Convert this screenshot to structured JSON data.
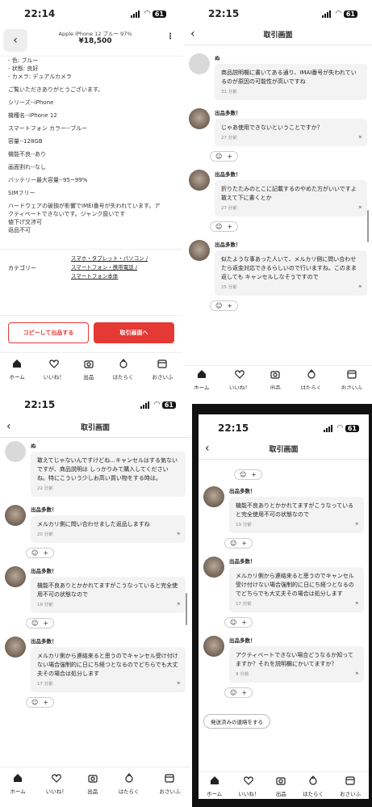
{
  "p1": {
    "time": "22:14",
    "battery": "61",
    "product_title": "Apple iPhone 12 ブルー 97%",
    "price": "¥18,500",
    "lines": [
      "- 色: ブルー",
      "- 状態: 良好",
      "- カメラ: デュアルカメラ",
      "",
      "ご覧いただきありがとうございます。",
      "",
      "シリーズ--iPhone",
      "",
      "機種名--iPhone 12",
      "",
      "スマートフォン カラー--ブルー",
      "",
      "容量--128GB",
      "",
      "機能不良--あり",
      "",
      "画面割れ--なし",
      "",
      "バッテリー最大容量--95~99%",
      "",
      "SIMフリー",
      "",
      "ハードウェアの破損が影響でIMEI番号が失われています。ア",
      "クティベートできないです。ジャンク扱いです",
      "値下げ交渉可",
      "返品不可"
    ],
    "category_label": "カテゴリー",
    "category_links": [
      "スマホ・タブレット・パソコン /",
      "スマートフォン・携帯電話 /",
      "スマートフォン本体"
    ],
    "copy_button": "コピーして出品する",
    "trade_button": "取引画面へ"
  },
  "header_title": "取引画面",
  "tabs": [
    "ホーム",
    "いいね！",
    "出品",
    "はたらく",
    "おさいふ"
  ],
  "p2": {
    "time": "22:15",
    "battery": "61",
    "messages": [
      {
        "sender": "ぬ",
        "text": "商品説明欄に書いてある通り、IMAI番号が失われているのが原因の可能性が高いですね",
        "time": "31 分前",
        "gray": true,
        "react": false
      },
      {
        "sender": "出品多数！",
        "text": "じゃあ使用できないということですか？",
        "time": "27 分前",
        "gray": false,
        "react": true
      },
      {
        "sender": "出品多数！",
        "text": "折りたたみのとこに記載するのやめた方がいいですよ敢えて下に書くとか",
        "time": "27 分前",
        "gray": false,
        "react": true
      },
      {
        "sender": "出品多数！",
        "text": "似たような事あった人いて、メルカリ側に問い合わせたら返金対応できるらしいので行いますね。このまま返しても キャンセルしなそうですので",
        "time": "25 分前",
        "gray": false,
        "react": true
      }
    ]
  },
  "p3": {
    "time": "22:15",
    "battery": "61",
    "messages": [
      {
        "sender": "ぬ",
        "text": "敢えてじゃないんですけどね...キャンセルはする気ないですが、商品説明は しっかりみて購入してくださいね。特にこういう少しお高い買い物をする時は。",
        "time": "22 分前",
        "gray": true,
        "react": false
      },
      {
        "sender": "出品多数！",
        "text": "メルカリ側に問い合わせました返品しますね",
        "time": "20 分前",
        "gray": false,
        "react": true
      },
      {
        "sender": "出品多数！",
        "text": "機能不良ありとかかれてますがこうなっていると完全使用不可の状態なので",
        "time": "19 分前",
        "gray": false,
        "react": true
      },
      {
        "sender": "出品多数！",
        "text": "メルカリ側から連絡来ると思うのでキャンセル受け付けない場合強制的に日にち経つとなるのでどちらでも大丈夫その場合は処分します",
        "time": "17 分前",
        "gray": false,
        "react": true
      }
    ]
  },
  "p4": {
    "time": "22:15",
    "battery": "61",
    "messages": [
      {
        "sender": "出品多数！",
        "text": "機能不良ありとかかれてますがこうなっていると完全使用不可の状態なので",
        "time": "19 分前",
        "gray": false,
        "react": true
      },
      {
        "sender": "出品多数！",
        "text": "メルカリ側から連絡来ると思うのでキャンセル受け付けない場合強制的に日にち経つとなるのでどちらでも大丈夫その場合は処分します",
        "time": "17 分前",
        "gray": false,
        "react": true
      },
      {
        "sender": "出品多数！",
        "text": "アクティベートできない場合どうなるか知ってますか？それを説明欄にかいてますか？",
        "time": "9 分前",
        "gray": false,
        "react": true
      }
    ],
    "send_contact_button": "発送済みの連絡をする"
  }
}
